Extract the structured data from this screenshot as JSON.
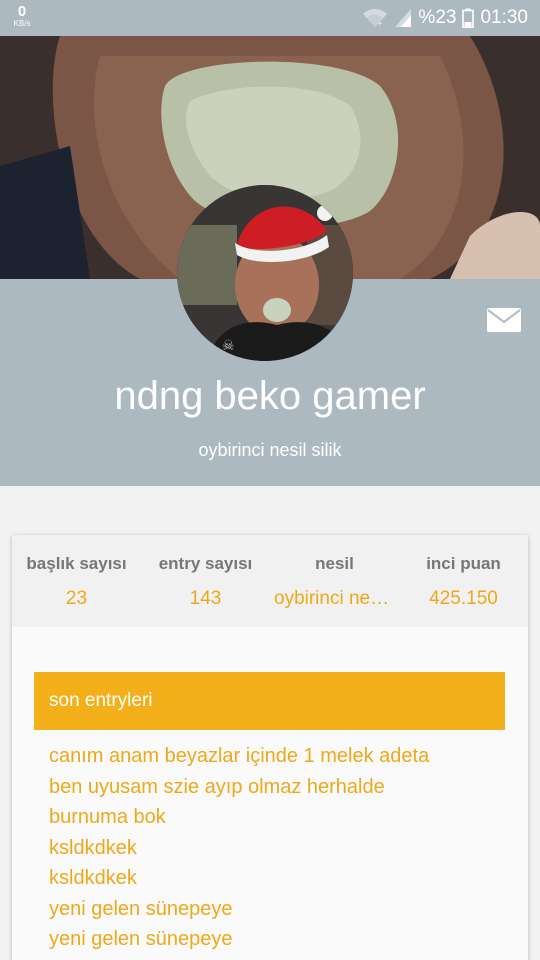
{
  "status_bar": {
    "net_speed_value": "0",
    "net_speed_unit": "KB/s",
    "battery_text": "%23",
    "time": "01:30"
  },
  "profile": {
    "username": "ndng beko gamer",
    "generation": "oybirinci nesil silik"
  },
  "stats": [
    {
      "label": "başlık sayısı",
      "value": "23"
    },
    {
      "label": "entry sayısı",
      "value": "143"
    },
    {
      "label": "nesil",
      "value": "oybirinci nesil silik"
    },
    {
      "label": "inci puan",
      "value": "425.150"
    }
  ],
  "recent_entries": {
    "title": "son entryleri",
    "items": [
      "canım anam beyazlar içinde 1 melek adeta",
      "ben uyusam szie ayıp olmaz herhalde",
      "burnuma bok",
      "ksldkdkek",
      "ksldkdkek",
      "yeni gelen sünepeye",
      "yeni gelen sünepeye"
    ]
  },
  "icons": {
    "wifi": "wifi-icon",
    "signal": "signal-icon",
    "battery": "battery-icon",
    "mail": "mail-icon"
  },
  "colors": {
    "header_bg": "#adb9c1",
    "accent": "#f4b01a",
    "accent_text": "#f0a818"
  }
}
